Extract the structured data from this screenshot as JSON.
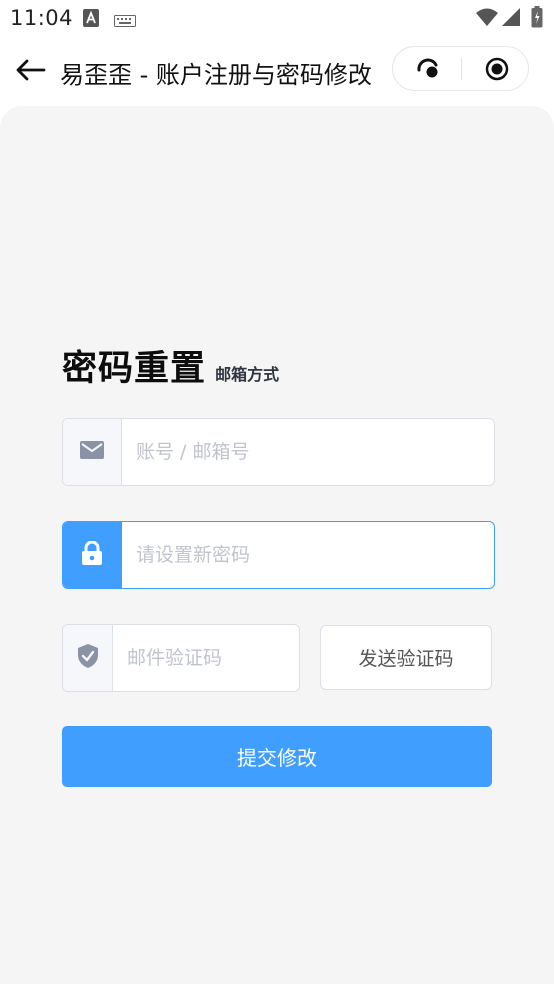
{
  "status_bar": {
    "time": "11:04",
    "icons": [
      "font-a-icon",
      "keyboard-icon",
      "wifi-icon",
      "signal-icon",
      "battery-icon"
    ]
  },
  "nav": {
    "title": "易歪歪 - 账户注册与密码修改",
    "back_icon": "arrow-left-icon",
    "capsule_icons": [
      "more-dots-icon",
      "close-target-icon"
    ]
  },
  "form": {
    "title": "密码重置",
    "subtitle": "邮箱方式",
    "account": {
      "placeholder": "账号 / 邮箱号",
      "value": "",
      "icon": "mail-icon"
    },
    "password": {
      "placeholder": "请设置新密码",
      "value": "",
      "icon": "lock-icon"
    },
    "code": {
      "placeholder": "邮件验证码",
      "value": "",
      "icon": "shield-icon"
    },
    "send_code_label": "发送验证码",
    "submit_label": "提交修改"
  },
  "colors": {
    "primary": "#409eff",
    "background": "#f5f5f6",
    "border": "#dcdfe6",
    "placeholder": "#c0c4cc"
  }
}
